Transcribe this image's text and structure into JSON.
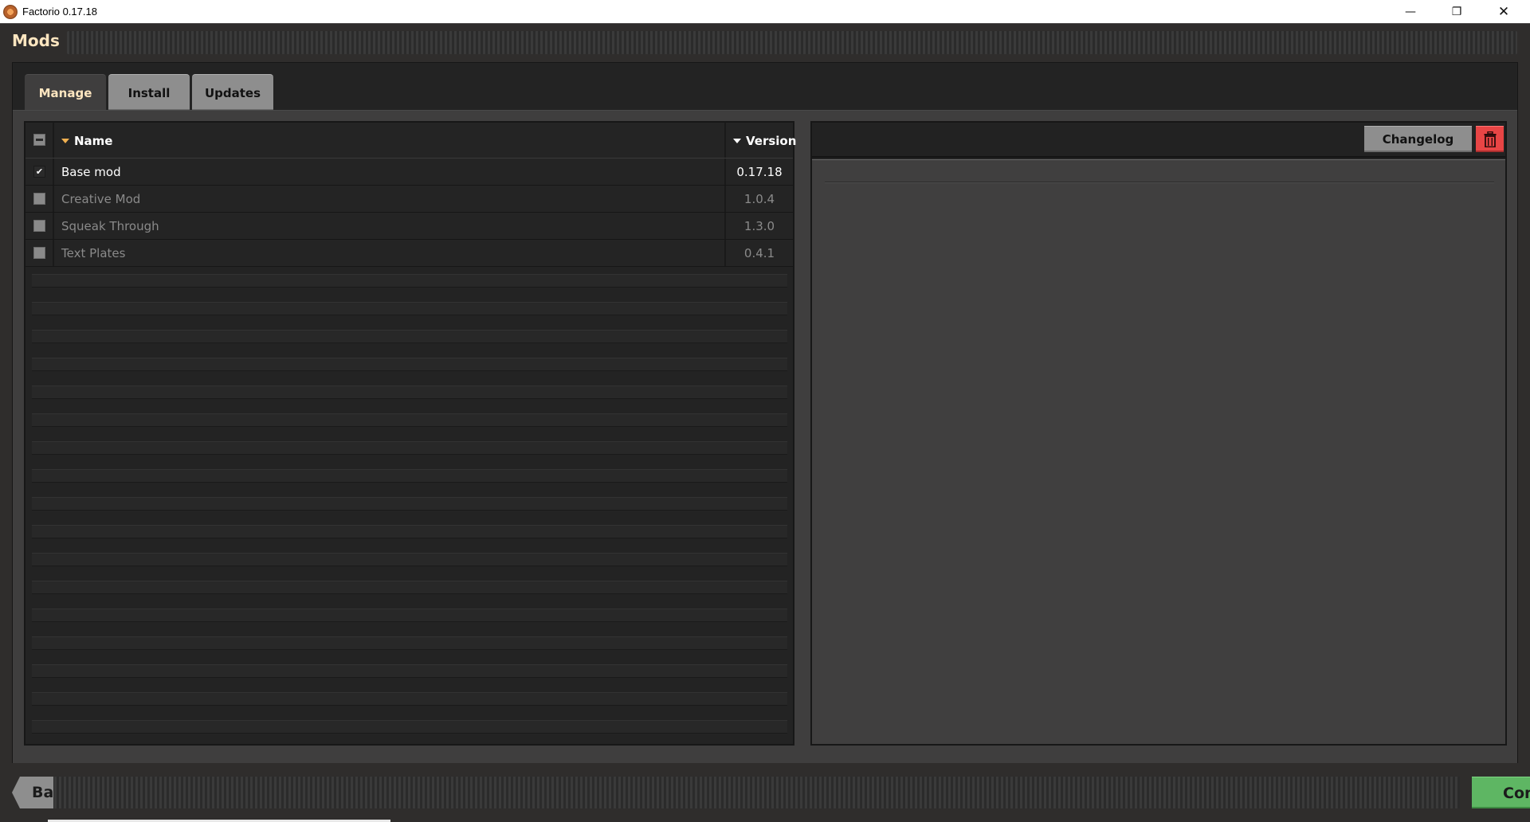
{
  "window": {
    "title": "Factorio 0.17.18",
    "icon": "factorio-gear-icon",
    "controls": {
      "minimize": "—",
      "maximize": "❐",
      "close": "✕"
    }
  },
  "page": {
    "title": "Mods"
  },
  "tabs": [
    {
      "label": "Manage",
      "active": true
    },
    {
      "label": "Install",
      "active": false
    },
    {
      "label": "Updates",
      "active": false
    }
  ],
  "table": {
    "columns": {
      "name": "Name",
      "version": "Version"
    },
    "sort_arrow_color_name": "#f0b050",
    "sort_arrow_color_version": "#ffffff",
    "rows": [
      {
        "name": "Base mod",
        "version": "0.17.18",
        "enabled": true
      },
      {
        "name": "Creative Mod",
        "version": "1.0.4",
        "enabled": false
      },
      {
        "name": "Squeak Through",
        "version": "1.3.0",
        "enabled": false
      },
      {
        "name": "Text Plates",
        "version": "0.4.1",
        "enabled": false
      }
    ]
  },
  "details": {
    "changelog_label": "Changelog",
    "delete_icon": "trash-icon"
  },
  "footer": {
    "back_label": "Back",
    "confirm_label": "Confirm"
  },
  "colors": {
    "title_accent": "#ffe6c0",
    "confirm_green": "#5eb663",
    "delete_red": "#e84545"
  }
}
